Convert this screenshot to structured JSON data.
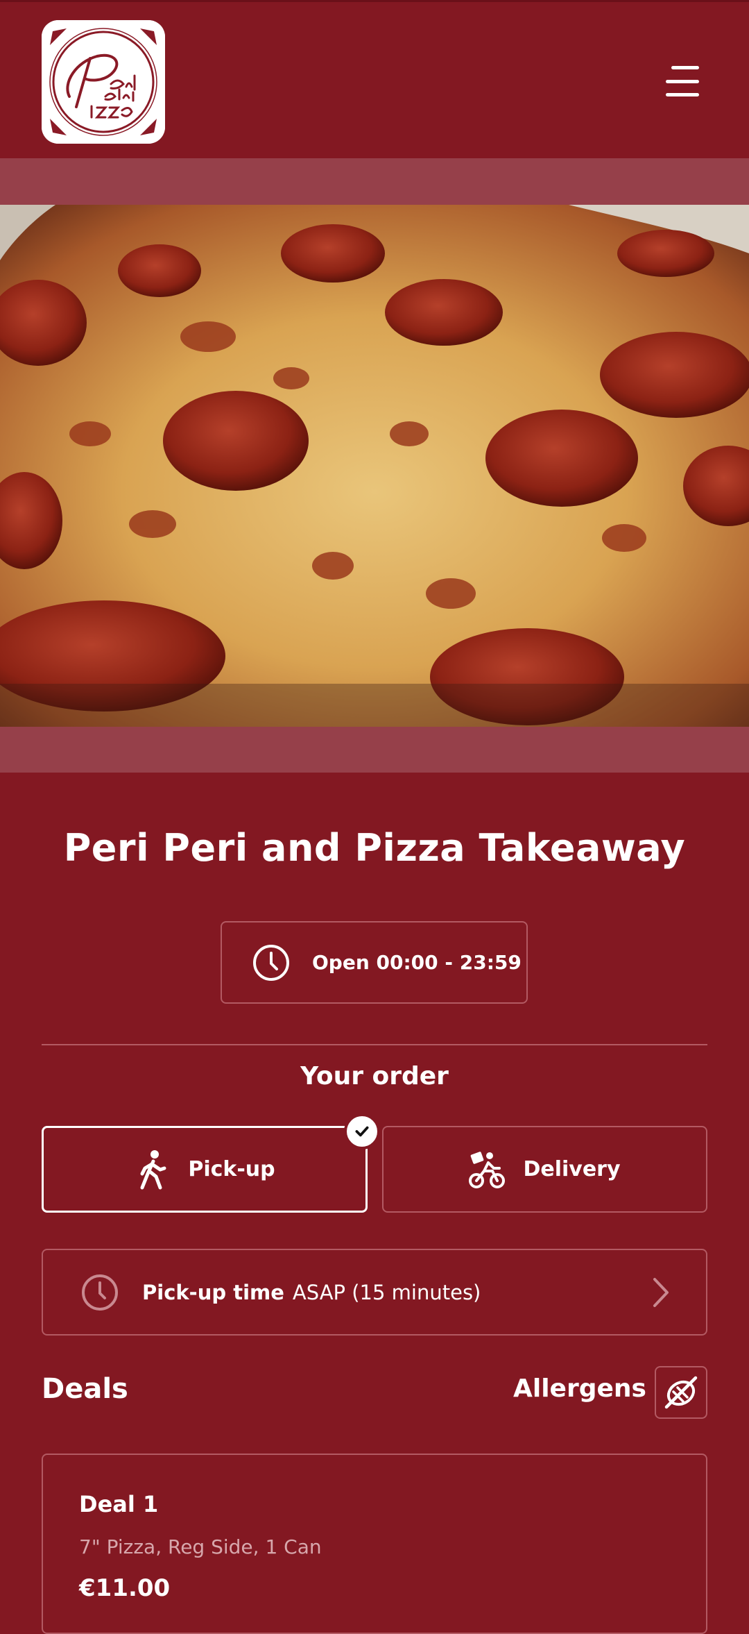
{
  "header": {
    "logo_alt": "Peri Peri Pizza",
    "menu_icon": "hamburger-menu-icon"
  },
  "hero": {
    "image": "pepperoni-pizza-photo"
  },
  "restaurant": {
    "name": "Peri Peri and Pizza Takeaway",
    "hours": "Open 00:00 - 23:59",
    "hours_icon": "clock-icon"
  },
  "order": {
    "title": "Your order",
    "modes": [
      {
        "label": "Pick-up",
        "icon": "walking-person-icon",
        "selected": true
      },
      {
        "label": "Delivery",
        "icon": "delivery-bike-icon",
        "selected": false
      }
    ],
    "time_label": "Pick-up time",
    "time_value": "ASAP (15 minutes)"
  },
  "menu": {
    "section_title": "Deals",
    "allergens_label": "Allergens",
    "allergens_icon": "allergens-icon",
    "items": [
      {
        "name": "Deal 1",
        "description": "7\" Pizza, Reg Side, 1 Can",
        "price": "€11.00"
      }
    ]
  },
  "colors": {
    "background": "#831822",
    "hero_band": "#96404a",
    "border": "#b35a63",
    "text": "#ffffff",
    "muted_text": "#d7a7ac"
  }
}
